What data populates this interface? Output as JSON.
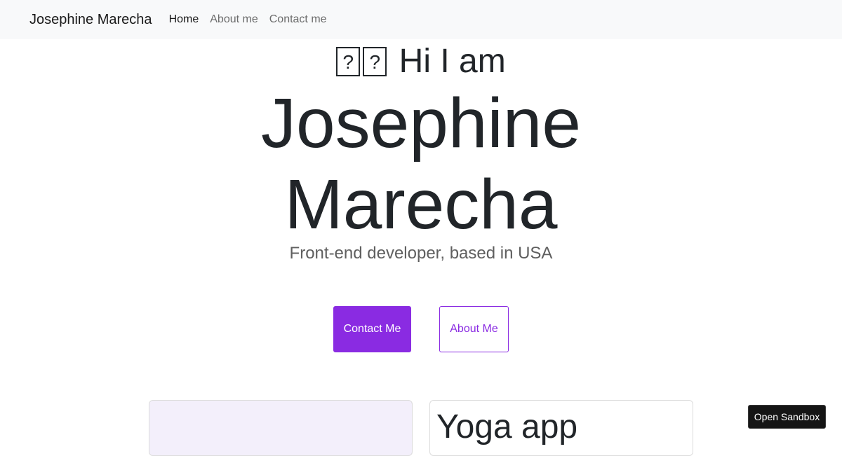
{
  "navbar": {
    "brand": "Josephine Marecha",
    "links": [
      {
        "label": "Home",
        "active": true
      },
      {
        "label": "About me",
        "active": false
      },
      {
        "label": "Contact me",
        "active": false
      }
    ]
  },
  "hero": {
    "greeting_text": "Hi I am",
    "greeting_icons": [
      "missing-glyph-icon",
      "missing-glyph-icon"
    ],
    "name_first": "Josephine",
    "name_last": "Marecha",
    "subtitle": "Front-end developer, based in USA"
  },
  "buttons": {
    "contact_label": "Contact Me",
    "about_label": "About Me"
  },
  "projects": {
    "right_card_title": "Yoga app"
  },
  "sandbox": {
    "label": "Open Sandbox"
  },
  "colors": {
    "accent": "#8a2be2",
    "navbar_bg": "#f8f9fa",
    "text_dark": "#212529",
    "text_muted": "#5f5f5f",
    "card_tint": "#f3effb"
  }
}
